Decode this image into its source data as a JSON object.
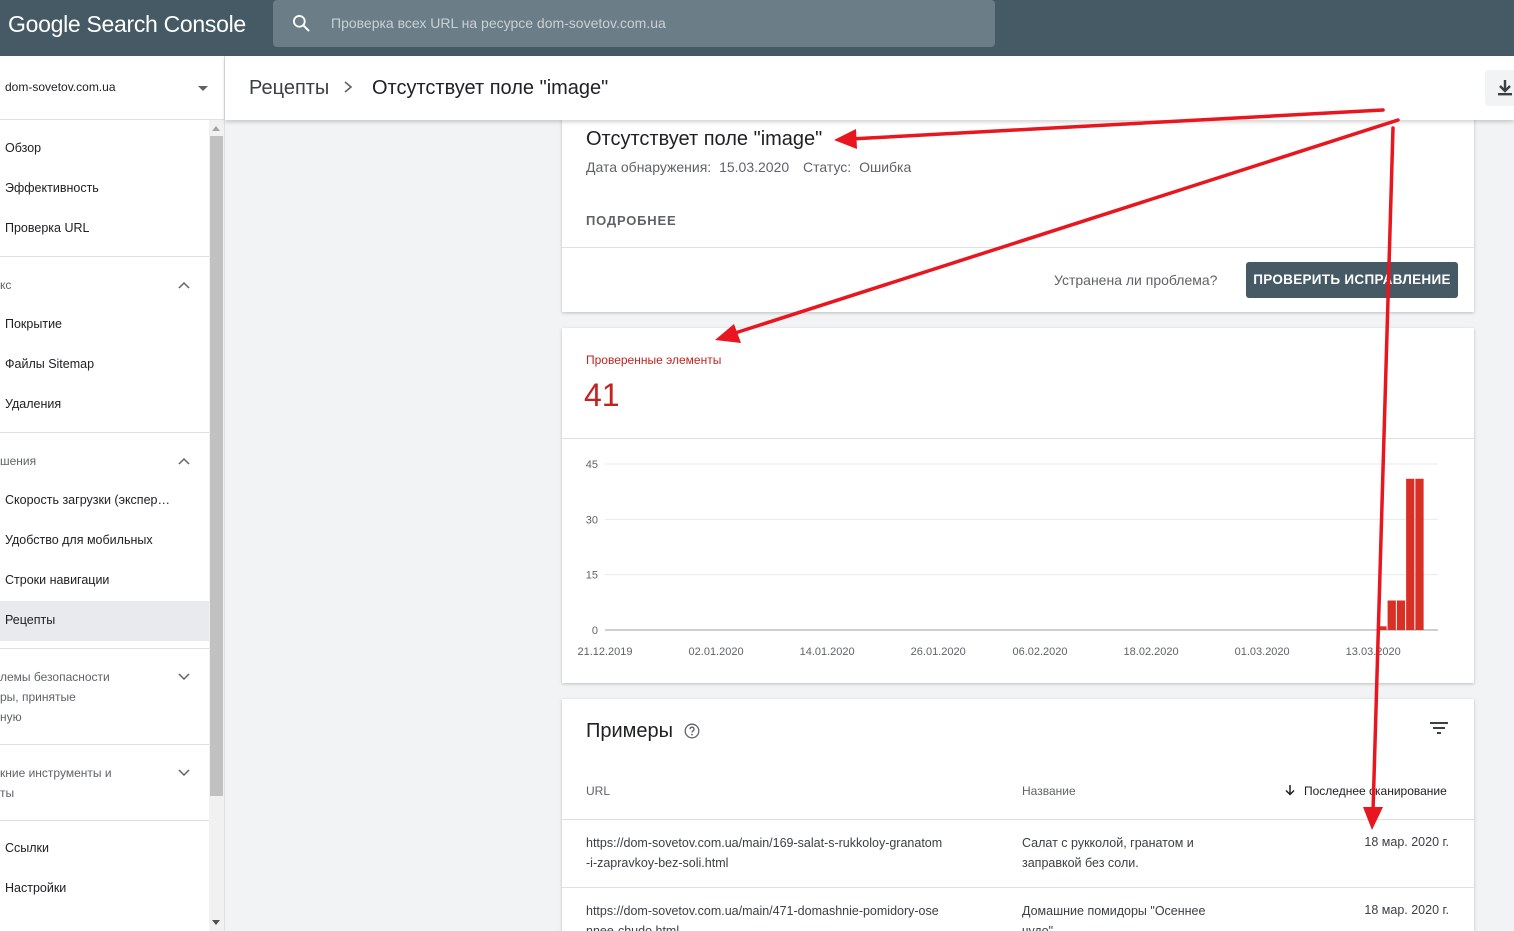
{
  "app": {
    "title": "Google Search Console",
    "search_placeholder": "Проверка всех URL на ресурсе dom-sovetov.com.ua"
  },
  "sidebar": {
    "property": "dom-sovetov.com.ua",
    "items_top": [
      "Обзор",
      "Эффективность",
      "Проверка URL"
    ],
    "section_index": "кс",
    "items_index": [
      "Покрытие",
      "Файлы Sitemap",
      "Удаления"
    ],
    "section_enh": "шения",
    "items_enh": [
      "Скорость загрузки (экспер…",
      "Удобство для мобильных",
      "Строки навигации",
      "Рецепты"
    ],
    "section_security": [
      "лемы безопасности",
      "ры, принятые",
      "ную"
    ],
    "section_legacy": [
      "кние инструменты и",
      "ты"
    ],
    "items_bottom": [
      "Ссылки",
      "Настройки"
    ]
  },
  "header": {
    "crumb_parent": "Рецепты",
    "crumb_current": "Отсутствует поле \"image\""
  },
  "issue": {
    "title": "Отсутствует поле \"image\"",
    "detected_label": "Дата обнаружения:",
    "detected_date": "15.03.2020",
    "status_label": "Статус:",
    "status_value": "Ошибка",
    "more": "ПОДРОБНЕЕ",
    "question": "Устранена ли проблема?",
    "validate_button": "ПРОВЕРИТЬ ИСПРАВЛЕНИЕ"
  },
  "checked": {
    "label": "Проверенные элементы",
    "value": "41"
  },
  "chart_data": {
    "type": "bar",
    "y_ticks": [
      "45",
      "30",
      "15",
      "0"
    ],
    "ylim": [
      0,
      45
    ],
    "x_tick_labels": [
      "21.12.2019",
      "02.01.2020",
      "14.01.2020",
      "26.01.2020",
      "06.02.2020",
      "18.02.2020",
      "01.03.2020",
      "13.03.2020"
    ],
    "x_range": [
      "2019-12-21",
      "2020-03-20"
    ],
    "bars": [
      {
        "date": "2020-03-14",
        "value": 1
      },
      {
        "date": "2020-03-15",
        "value": 8
      },
      {
        "date": "2020-03-16",
        "value": 8
      },
      {
        "date": "2020-03-17",
        "value": 41
      },
      {
        "date": "2020-03-18",
        "value": 41
      }
    ],
    "color": "#d93025",
    "grid": true
  },
  "examples": {
    "title": "Примеры",
    "col_url": "URL",
    "col_name": "Название",
    "col_date": "Последнее сканирование",
    "rows": [
      {
        "url_line1": "https://dom-sovetov.com.ua/main/169-salat-s-rukkoloy-granatom",
        "url_line2": "-i-zapravkoy-bez-soli.html",
        "name_line1": "Салат с рукколой, гранатом и",
        "name_line2": "заправкой без соли.",
        "date": "18 мар. 2020 г."
      },
      {
        "url_line1": "https://dom-sovetov.com.ua/main/471-domashnie-pomidory-ose",
        "url_line2": "nnee-chudo.html",
        "name_line1": "Домашние помидоры \"Осеннее",
        "name_line2": "чудо\"",
        "date": "18 мар. 2020 г."
      }
    ]
  }
}
